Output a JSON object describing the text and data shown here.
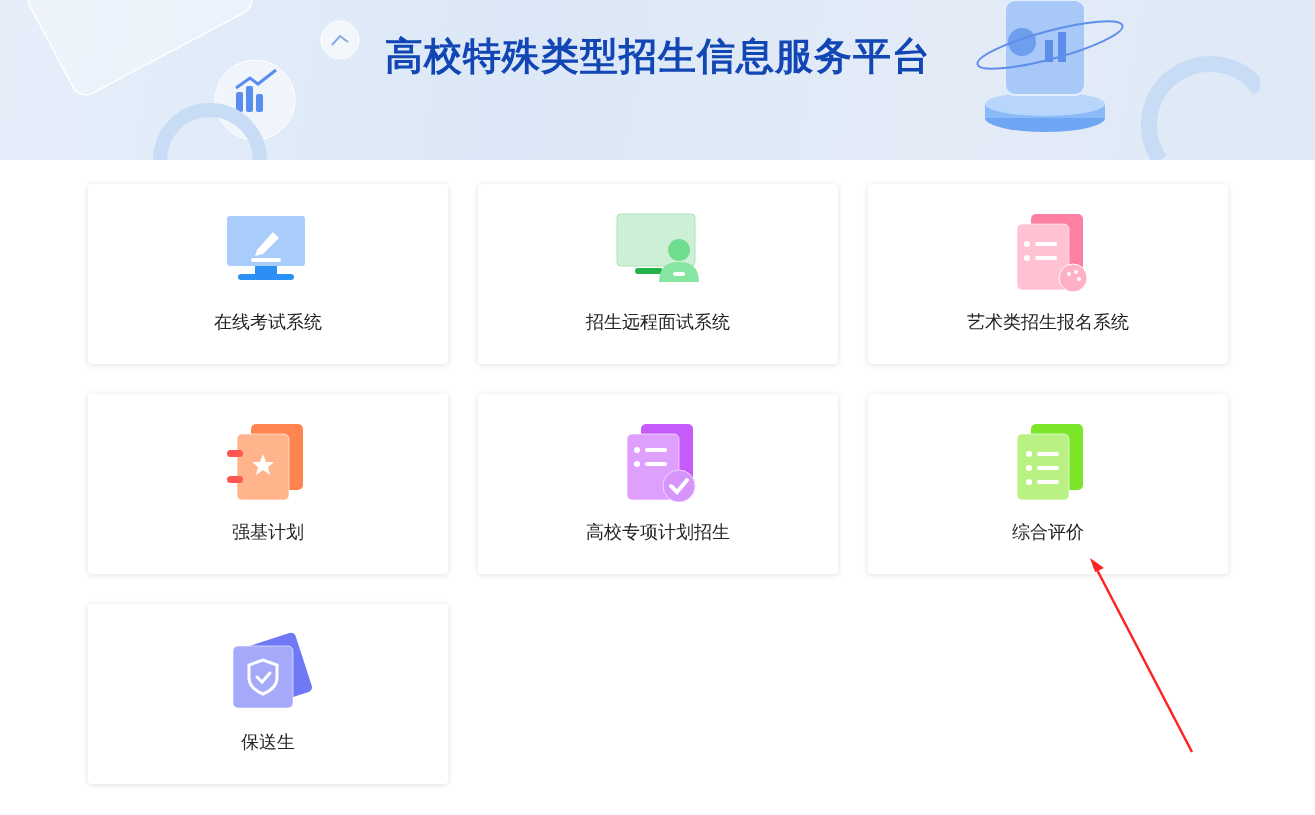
{
  "banner": {
    "title": "高校特殊类型招生信息服务平台"
  },
  "systems": [
    {
      "label": "在线考试系统",
      "kind": "monitor-pen"
    },
    {
      "label": "招生远程面试系统",
      "kind": "monitor-person"
    },
    {
      "label": "艺术类招生报名系统",
      "kind": "palette-doc"
    },
    {
      "label": "强基计划",
      "kind": "star-notebook"
    },
    {
      "label": "高校专项计划招生",
      "kind": "check-doc"
    },
    {
      "label": "综合评价",
      "kind": "list-doc"
    },
    {
      "label": "保送生",
      "kind": "shield"
    }
  ]
}
